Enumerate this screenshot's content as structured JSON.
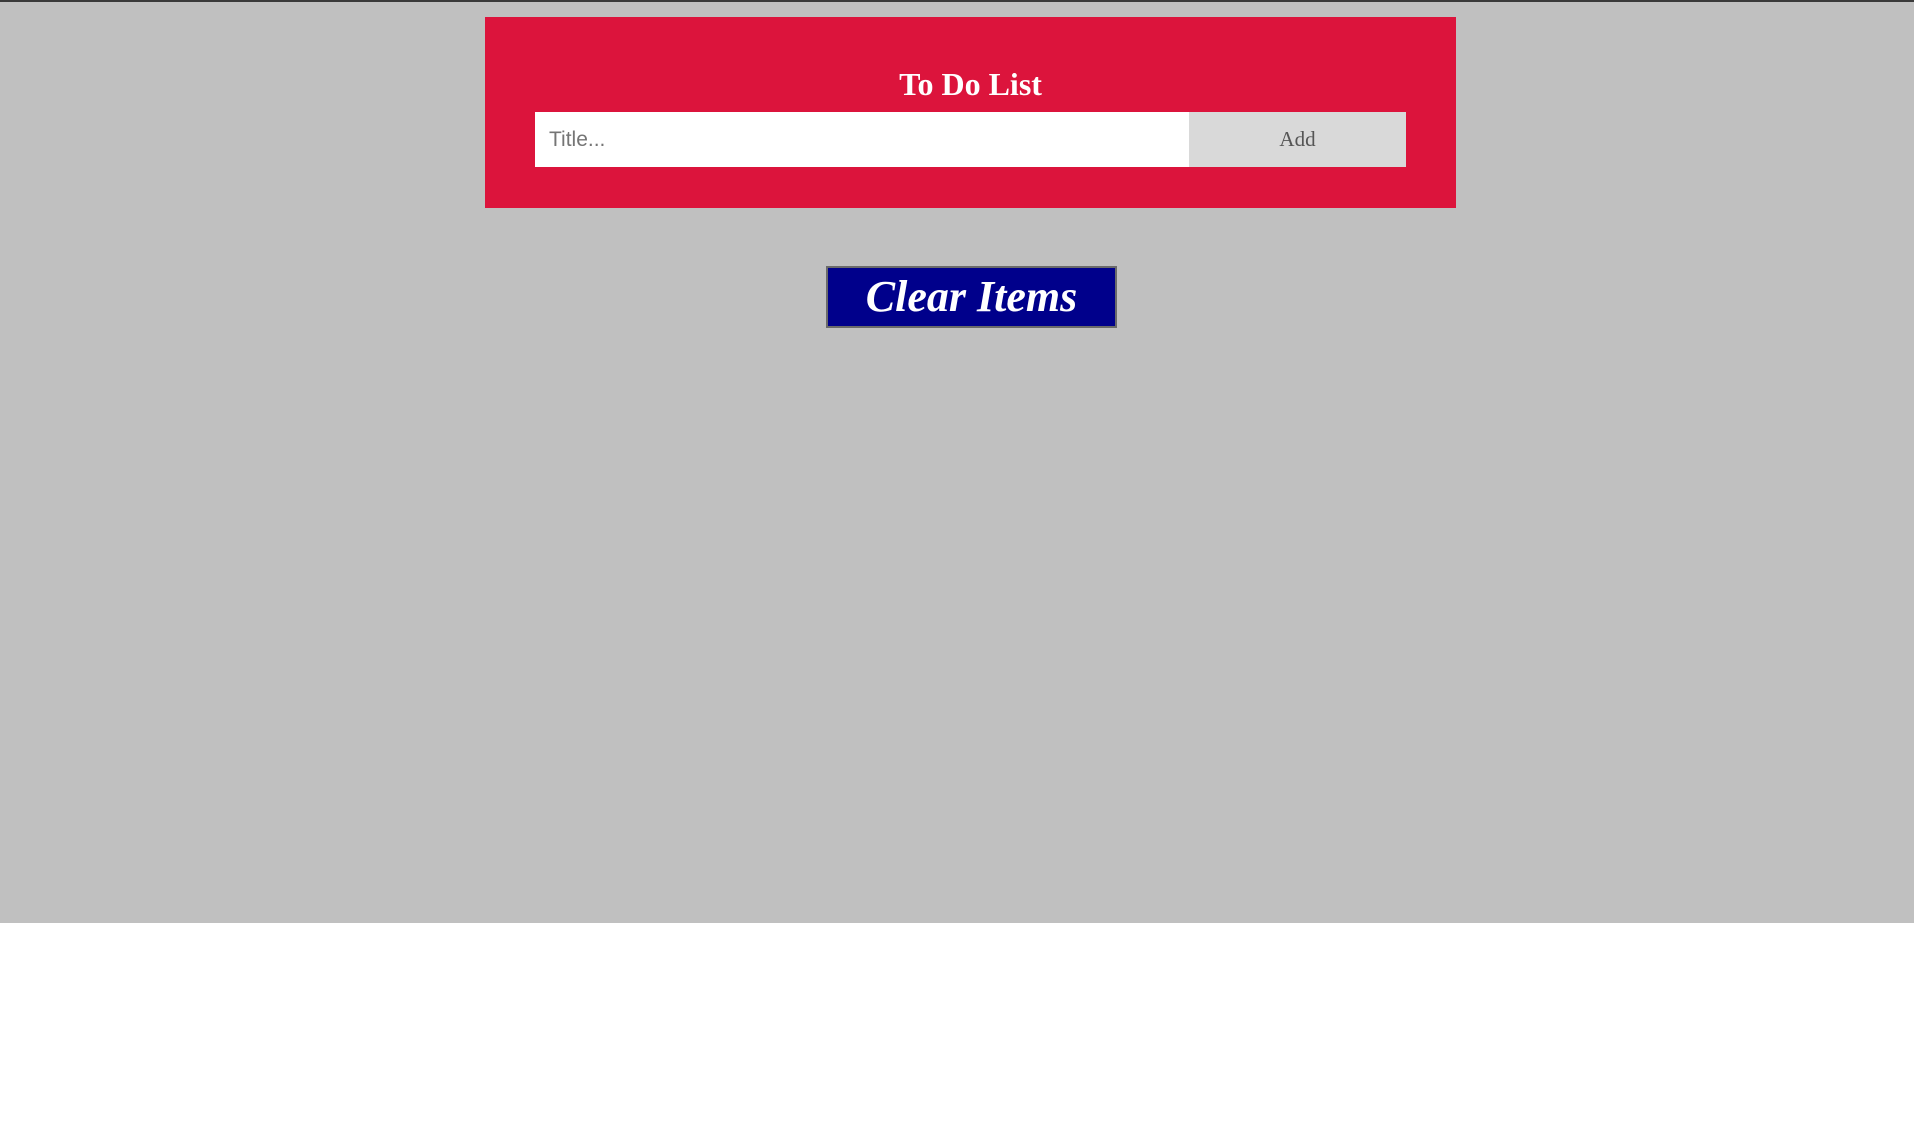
{
  "header": {
    "title": "To Do List",
    "input_placeholder": "Title...",
    "input_value": "",
    "add_label": "Add"
  },
  "actions": {
    "clear_label": "Clear Items"
  },
  "colors": {
    "page_background": "#c0c0c0",
    "header_background": "#dc143c",
    "add_button_background": "#d9d9d9",
    "clear_button_background": "#00008b"
  },
  "todo_items": []
}
